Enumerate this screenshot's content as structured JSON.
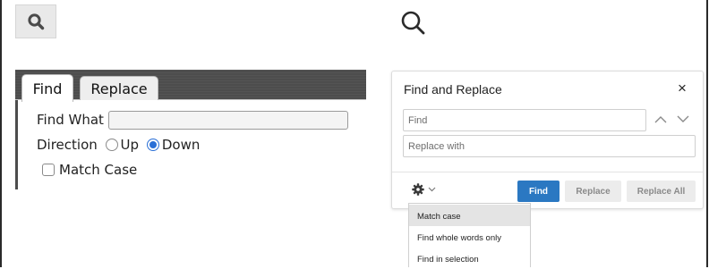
{
  "classic_find": {
    "search_icon": "search-icon",
    "tabs": [
      {
        "label": "Find",
        "active": true
      },
      {
        "label": "Replace",
        "active": false
      }
    ],
    "find_what_label": "Find What",
    "find_what_value": "",
    "direction_label": "Direction",
    "direction_options": [
      {
        "label": "Up",
        "selected": false
      },
      {
        "label": "Down",
        "selected": true
      }
    ],
    "match_case_label": "Match Case",
    "match_case_checked": false
  },
  "modern_find": {
    "search_icon": "search-icon",
    "title": "Find and Replace",
    "close_label": "×",
    "find_placeholder": "Find",
    "replace_placeholder": "Replace with",
    "prev_icon": "chevron-up-icon",
    "next_icon": "chevron-down-icon",
    "options_icon": "gear-icon",
    "buttons": {
      "find": "Find",
      "replace": "Replace",
      "replace_all": "Replace All"
    },
    "options_menu": [
      {
        "label": "Match case",
        "highlighted": true
      },
      {
        "label": "Find whole words only",
        "highlighted": false
      },
      {
        "label": "Find in selection",
        "highlighted": false
      }
    ],
    "accent_color": "#2b78c2"
  }
}
